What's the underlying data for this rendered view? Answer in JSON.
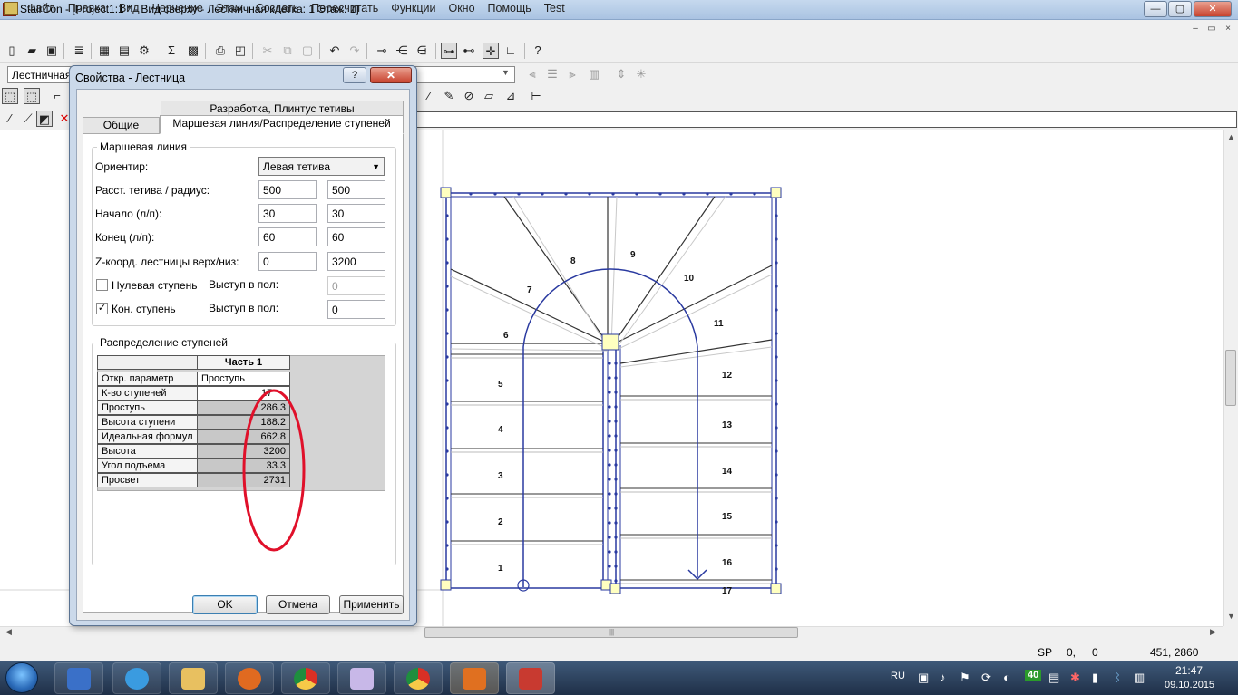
{
  "window": {
    "title": "StairCon - [Project1:1 * - Вид сверху - Лестничная клетка: 1 Этаж: 1]",
    "minimize": "—",
    "maximize": "▢",
    "close": "✕"
  },
  "menu": [
    "Файл",
    "Правка",
    "Вид",
    "Черчение",
    "Этаж",
    "Создать",
    "Пересчитать",
    "Функции",
    "Окно",
    "Помощь",
    "Test"
  ],
  "mdi_controls": [
    "–",
    "▭",
    "×"
  ],
  "toolbar": {
    "layer_value": "Лестничная"
  },
  "dialog": {
    "title": "Свойства - Лестница",
    "help": "?",
    "close": "✕",
    "tabs": {
      "top": "Разработка, Плинтус тетивы",
      "general": "Общие",
      "walkline": "Маршевая линия/Распределение ступеней"
    },
    "walkline_group": {
      "title": "Маршевая линия",
      "orient_label": "Ориентир:",
      "orient_value": "Левая тетива",
      "dist_label": "Расст. тетива / радиус:",
      "dist_a": "500",
      "dist_b": "500",
      "start_label": "Начало (л/п):",
      "start_a": "30",
      "start_b": "30",
      "end_label": "Конец (л/п):",
      "end_a": "60",
      "end_b": "60",
      "z_label": "Z-коорд. лестницы верх/низ:",
      "z_a": "0",
      "z_b": "3200",
      "zero_step_label": "Нулевая ступень",
      "zero_step_checked": false,
      "zero_protr_label": "Выступ в пол:",
      "zero_protr_value": "0",
      "end_step_label": "Кон. ступень",
      "end_step_checked": true,
      "end_protr_label": "Выступ в пол:",
      "end_protr_value": "0"
    },
    "dist_group": {
      "title": "Распределение ступеней",
      "column_header": "Часть 1",
      "rows": [
        {
          "name": "Откр. параметр",
          "value": "Проступь"
        },
        {
          "name": "К-во ступеней",
          "value": "17"
        },
        {
          "name": "Проступь",
          "value": "286.3"
        },
        {
          "name": "Высота ступени",
          "value": "188.2"
        },
        {
          "name": "Идеальная формул",
          "value": "662.8"
        },
        {
          "name": "Высота",
          "value": "3200"
        },
        {
          "name": "Угол подъема",
          "value": "33.3"
        },
        {
          "name": "Просвет",
          "value": "2731"
        }
      ]
    },
    "buttons": {
      "ok": "OK",
      "cancel": "Отмена",
      "apply": "Применить"
    }
  },
  "drawing": {
    "step_numbers": [
      "1",
      "2",
      "3",
      "4",
      "5",
      "6",
      "7",
      "8",
      "9",
      "10",
      "11",
      "12",
      "13",
      "14",
      "15",
      "16",
      "17"
    ]
  },
  "status": {
    "mode": "SP",
    "a": "0,",
    "b": "0",
    "coords": "451,  2860"
  },
  "taskbar": {
    "lang": "RU",
    "badge": "40",
    "time": "21:47",
    "date": "09.10.2015"
  },
  "colors": {
    "annotation": "#e0102a",
    "plan_line": "#2a3aa0",
    "node_fill": "#ffffc0"
  }
}
